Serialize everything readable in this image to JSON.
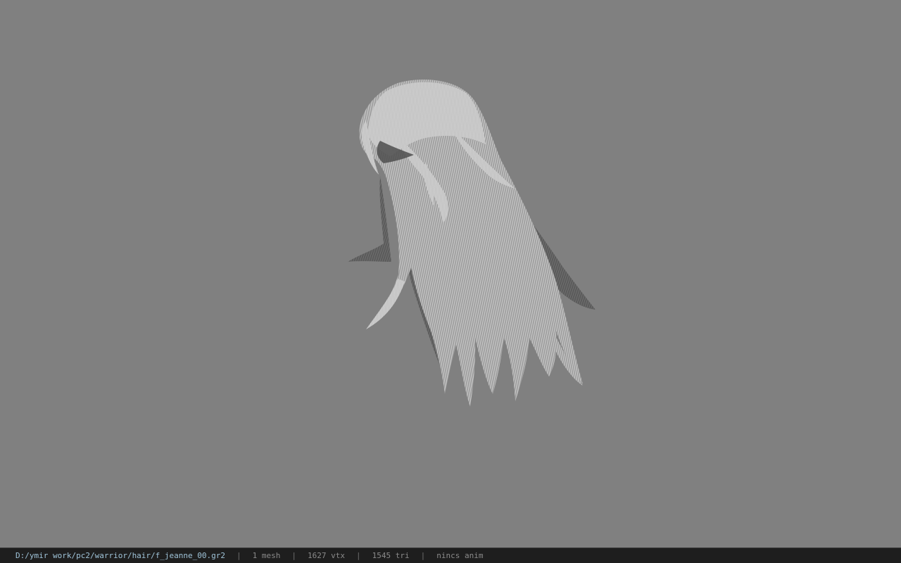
{
  "viewport": {
    "background_color": "#808080",
    "model_name": "hair-mesh"
  },
  "statusbar": {
    "file_path": "D:/ymir work/pc2/warrior/hair/f_jeanne_00.gr2",
    "separator": "|",
    "mesh_count": "1 mesh",
    "vertex_count": "1627 vtx",
    "triangle_count": "1545 tri",
    "anim_label": "nincs anim"
  }
}
